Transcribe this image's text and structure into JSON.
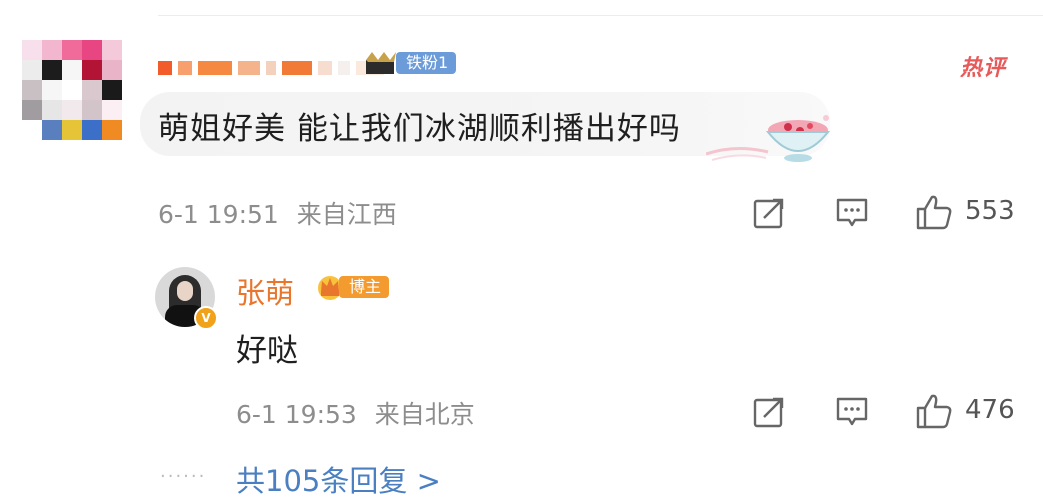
{
  "comment": {
    "fan_badge": "铁粉1",
    "hot_tag": "热评",
    "text": "萌姐好美 能让我们冰湖顺利播出好吗",
    "time": "6-1 19:51",
    "location": "来自江西",
    "likes": "553"
  },
  "reply": {
    "author": "张萌",
    "badge": "博主",
    "text": "好哒",
    "time": "6-1 19:53",
    "location": "来自北京",
    "likes": "476"
  },
  "more_replies": "共105条回复 >",
  "icons": [
    "share-icon",
    "comment-icon",
    "like-icon",
    "verified-icon",
    "crown-icon"
  ],
  "colors": {
    "accent_blue": "#4a7fc1",
    "name_orange": "#e8762d",
    "hot_red": "#e85a5a",
    "fan_blue": "#6b9bd8"
  }
}
